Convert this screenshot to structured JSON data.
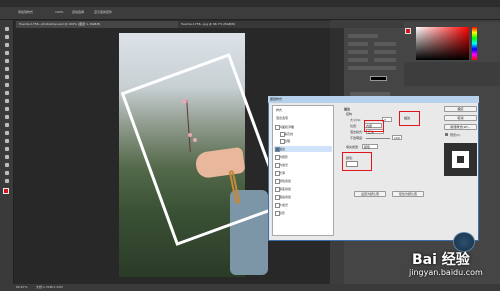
{
  "options_bar": {
    "item1": "添加到样式",
    "item2": "100%",
    "item3": "自动选择",
    "item4": "显示变换控件"
  },
  "doc_tabs": [
    {
      "label": "Tuanha-1736...photoshop.psd @ 100% (图层 1, RGB/8)"
    },
    {
      "label": "Tuanha-1736...jpg @ 66.7% (RGB/8)"
    }
  ],
  "dialog": {
    "title": "图层样式",
    "styles": [
      {
        "label": "样式",
        "checked": false,
        "selected": false
      },
      {
        "label": "混合选项",
        "checked": false,
        "selected": false
      },
      {
        "label": "斜面和浮雕",
        "checked": false,
        "selected": false
      },
      {
        "label": "等高线",
        "checked": false,
        "selected": false
      },
      {
        "label": "纹理",
        "checked": false,
        "selected": false
      },
      {
        "label": "描边",
        "checked": true,
        "selected": true
      },
      {
        "label": "内阴影",
        "checked": false,
        "selected": false
      },
      {
        "label": "内发光",
        "checked": false,
        "selected": false
      },
      {
        "label": "光泽",
        "checked": false,
        "selected": false
      },
      {
        "label": "颜色叠加",
        "checked": false,
        "selected": false
      },
      {
        "label": "渐变叠加",
        "checked": false,
        "selected": false
      },
      {
        "label": "图案叠加",
        "checked": false,
        "selected": false
      },
      {
        "label": "外发光",
        "checked": false,
        "selected": false
      },
      {
        "label": "投影",
        "checked": false,
        "selected": false
      }
    ],
    "section_title": "描边",
    "structure_label": "结构",
    "size_label": "大小(S):",
    "size_value": "3",
    "position_label": "位置:",
    "position_value": "内部",
    "blend_label": "混合模式:",
    "blend_value": "正常",
    "opacity_label": "不透明度:",
    "opacity_value": "100",
    "fill_label": "填充类型:",
    "fill_value": "颜色",
    "color_label": "颜色:",
    "color_value": "#ffffff",
    "default_btn": "设置为默认值",
    "reset_btn": "复位为默认值",
    "ok_btn": "确定",
    "cancel_btn": "取消",
    "new_style_btn": "新建样式(W)...",
    "preview_label": "预览(V)",
    "highlight_color": "#e0161d"
  },
  "status": {
    "zoom": "66.67%",
    "doc": "文档:1.32M/1.32M"
  },
  "watermark": {
    "brand": "Bai 经验",
    "url": "jingyan.baidu.com"
  }
}
